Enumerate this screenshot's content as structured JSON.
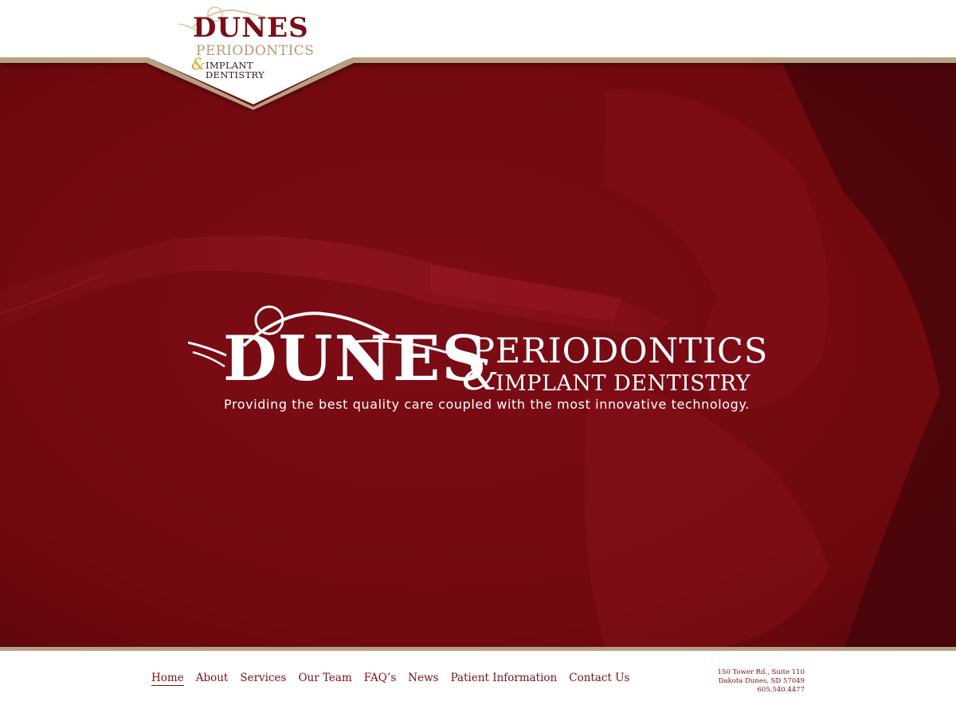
{
  "brand": {
    "logo_line1": "DUNES",
    "logo_line2": "PERIODONTICS",
    "logo_amp": "&",
    "logo_line3": "IMPLANT DENTISTRY"
  },
  "nav": {
    "items": [
      {
        "label": "Home",
        "active": true
      },
      {
        "label": "About"
      },
      {
        "label": "Services"
      },
      {
        "label": "Our Team"
      },
      {
        "label": "FAQ’s"
      },
      {
        "label": "News"
      },
      {
        "label": "Patient Information"
      },
      {
        "label": "Contact Us"
      }
    ]
  },
  "hero": {
    "logo_line1": "DUNES",
    "logo_line2": "PERIODONTICS",
    "logo_amp": "&",
    "logo_line3": "IMPLANT DENTISTRY",
    "tagline": "Providing the best quality care coupled with the most innovative technology."
  },
  "footer": {
    "nav": [
      {
        "label": "Home",
        "active": true
      },
      {
        "label": "About"
      },
      {
        "label": "Services"
      },
      {
        "label": "Our Team"
      },
      {
        "label": "FAQ’s"
      },
      {
        "label": "News"
      },
      {
        "label": "Patient Information"
      },
      {
        "label": "Contact Us"
      }
    ],
    "address_line1": "150 Tower Rd., Suite 110",
    "address_line2": "Dakota Dunes, SD 57049",
    "phone": "605.540.4477"
  },
  "colors": {
    "brand_red": "#7a0e17",
    "hero_red": "#730912",
    "gold_stripe": "#b5a184",
    "accent_gold": "#d4aa2c"
  }
}
